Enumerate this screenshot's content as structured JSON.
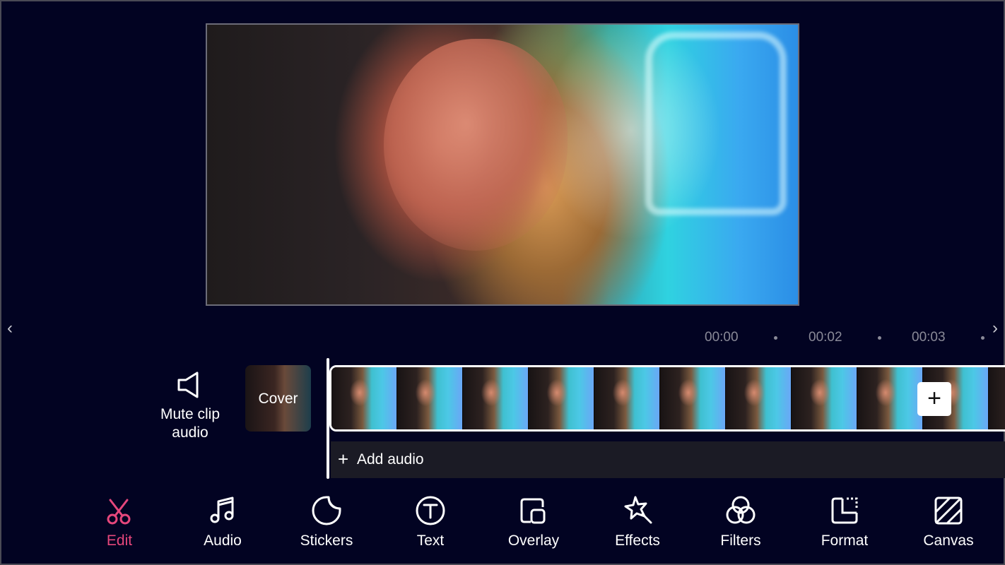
{
  "timeline": {
    "ticks": [
      "00:00",
      "00:02",
      "00:03"
    ]
  },
  "clip_controls": {
    "mute_label_line1": "Mute clip",
    "mute_label_line2": "audio",
    "cover_label": "Cover"
  },
  "audio_track": {
    "add_audio_label": "Add audio"
  },
  "toolbar": {
    "active_color": "#e6477c",
    "items": [
      {
        "label": "Edit",
        "icon": "scissors-icon",
        "active": true
      },
      {
        "label": "Audio",
        "icon": "music-note-icon",
        "active": false
      },
      {
        "label": "Stickers",
        "icon": "sticker-icon",
        "active": false
      },
      {
        "label": "Text",
        "icon": "text-icon",
        "active": false
      },
      {
        "label": "Overlay",
        "icon": "overlay-icon",
        "active": false
      },
      {
        "label": "Effects",
        "icon": "effects-icon",
        "active": false
      },
      {
        "label": "Filters",
        "icon": "filters-icon",
        "active": false
      },
      {
        "label": "Format",
        "icon": "format-icon",
        "active": false
      },
      {
        "label": "Canvas",
        "icon": "canvas-icon",
        "active": false
      }
    ]
  }
}
